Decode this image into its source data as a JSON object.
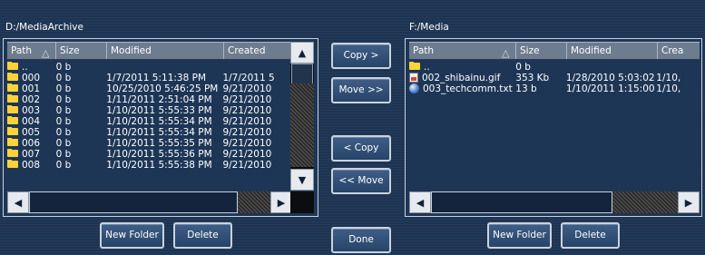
{
  "left_panel": {
    "path": "D:/MediaArchive",
    "columns": [
      "Path",
      "Size",
      "Modified",
      "Created"
    ],
    "rows": [
      {
        "name": "..",
        "size": "0 b",
        "modified": "",
        "created": "",
        "icon": "folder-icon"
      },
      {
        "name": "000",
        "size": "0 b",
        "modified": "1/7/2011 5:11:38 PM",
        "created": "1/7/2011 5",
        "icon": "folder-icon"
      },
      {
        "name": "001",
        "size": "0 b",
        "modified": "10/25/2010 5:46:25 PM",
        "created": "9/21/2010",
        "icon": "folder-icon"
      },
      {
        "name": "002",
        "size": "0 b",
        "modified": "1/11/2011 2:51:04 PM",
        "created": "9/21/2010",
        "icon": "folder-icon"
      },
      {
        "name": "003",
        "size": "0 b",
        "modified": "1/10/2011 5:55:33 PM",
        "created": "9/21/2010",
        "icon": "folder-icon"
      },
      {
        "name": "004",
        "size": "0 b",
        "modified": "1/10/2011 5:55:34 PM",
        "created": "9/21/2010",
        "icon": "folder-icon"
      },
      {
        "name": "005",
        "size": "0 b",
        "modified": "1/10/2011 5:55:34 PM",
        "created": "9/21/2010",
        "icon": "folder-icon"
      },
      {
        "name": "006",
        "size": "0 b",
        "modified": "1/10/2011 5:55:35 PM",
        "created": "9/21/2010",
        "icon": "folder-icon"
      },
      {
        "name": "007",
        "size": "0 b",
        "modified": "1/10/2011 5:55:36 PM",
        "created": "9/21/2010",
        "icon": "folder-icon"
      },
      {
        "name": "008",
        "size": "0 b",
        "modified": "1/10/2011 5:55:38 PM",
        "created": "9/21/2010",
        "icon": "folder-icon"
      }
    ],
    "new_folder_label": "New Folder",
    "delete_label": "Delete"
  },
  "right_panel": {
    "path": "F:/Media",
    "columns": [
      "Path",
      "Size",
      "Modified",
      "Crea"
    ],
    "rows": [
      {
        "name": "..",
        "size": "0 b",
        "modified": "",
        "created": "",
        "icon": "folder-icon"
      },
      {
        "name": "002_shibainu.gif",
        "size": "353 Kb",
        "modified": "1/28/2010 5:03:02 PM",
        "created": "1/10,",
        "icon": "gif-file-icon"
      },
      {
        "name": "003_techcomm.txt",
        "size": "13 b",
        "modified": "1/10/2011 1:15:00 PM",
        "created": "1/10,",
        "icon": "text-file-icon"
      }
    ],
    "new_folder_label": "New Folder",
    "delete_label": "Delete"
  },
  "actions": {
    "copy_right": "Copy >",
    "move_right": "Move >>",
    "copy_left": "< Copy",
    "move_left": "<< Move",
    "done": "Done"
  },
  "theme": {
    "background": "#1d3453",
    "header": "#6d7c8e",
    "button": "#2f4d76",
    "folder": "#ffd23a"
  }
}
